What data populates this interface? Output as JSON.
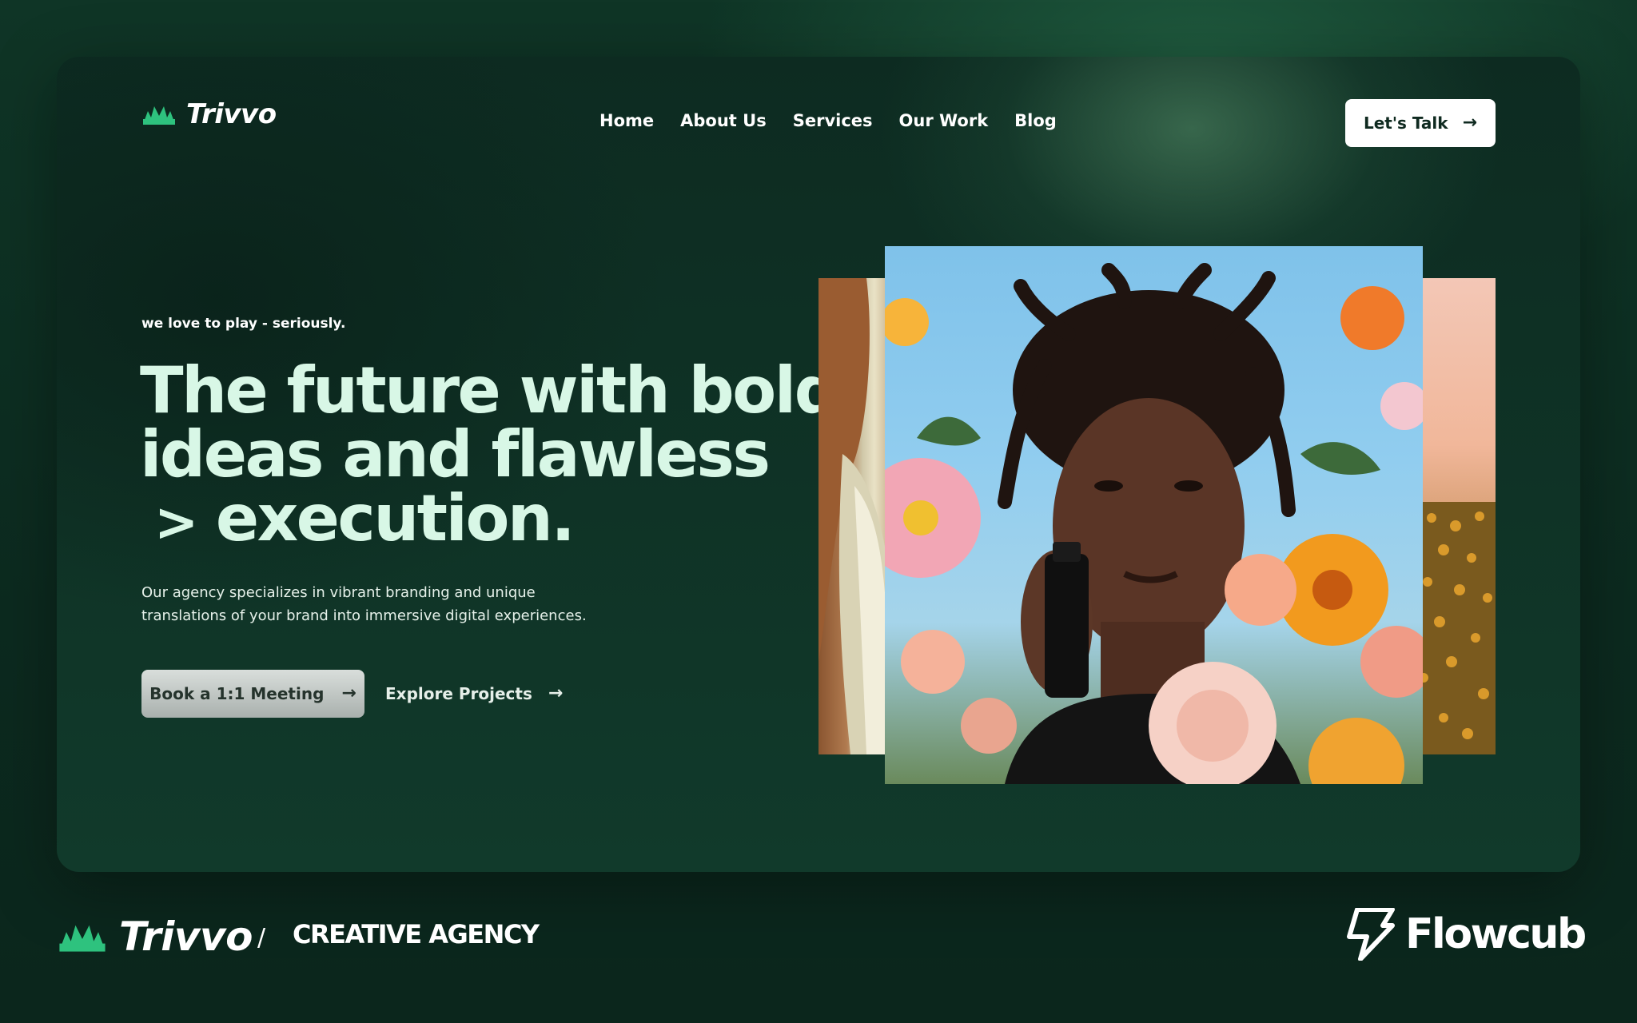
{
  "brand": {
    "name": "Trivvo",
    "logo_icon": "leaf-crown-icon",
    "accent": "#2ec27e"
  },
  "nav": {
    "items": [
      {
        "label": "Home"
      },
      {
        "label": "About Us"
      },
      {
        "label": "Services"
      },
      {
        "label": "Our Work"
      },
      {
        "label": "Blog"
      }
    ],
    "cta_label": "Let's Talk"
  },
  "hero": {
    "eyebrow": "we love to play - seriously.",
    "headline_line1": "The future with bold",
    "headline_line2": "ideas and flawless",
    "headline_chevron": ">",
    "headline_line3": "execution.",
    "description": "Our agency specializes in vibrant branding and unique translations of your brand into immersive digital experiences.",
    "primary_button": "Book a 1:1 Meeting",
    "secondary_button": "Explore Projects",
    "arrow": "→"
  },
  "footer": {
    "brand": "Trivvo",
    "separator": "/",
    "tagline": "CREATIVE AGENCY",
    "partner": "Flowcub",
    "partner_icon": "lightning-bolt-icon"
  },
  "colors": {
    "background": "#0f3326",
    "headline": "#d8f7e6",
    "button_dark_text": "#0f2a20"
  }
}
